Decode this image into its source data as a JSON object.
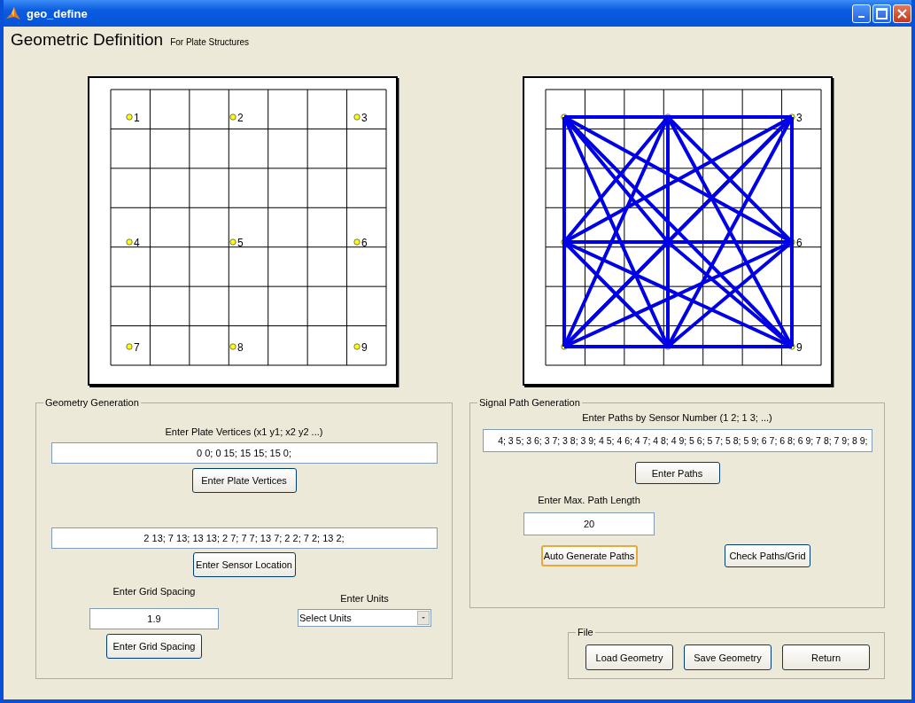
{
  "window": {
    "title": "geo_define"
  },
  "header": {
    "title": "Geometric Definition",
    "subtitle": "For Plate Structures"
  },
  "plots": [
    {
      "kind": "sensor-map",
      "sensors": [
        {
          "label": "1"
        },
        {
          "label": "2"
        },
        {
          "label": "3"
        },
        {
          "label": "4"
        },
        {
          "label": "5"
        },
        {
          "label": "6"
        },
        {
          "label": "7"
        },
        {
          "label": "8"
        },
        {
          "label": "9"
        }
      ]
    },
    {
      "kind": "path-map",
      "labels": [
        {
          "text": "3"
        },
        {
          "text": "6"
        },
        {
          "text": "9"
        }
      ]
    }
  ],
  "geometry_panel": {
    "title": "Geometry Generation",
    "vertices_label": "Enter Plate Vertices (x1 y1; x2 y2 ...)",
    "vertices_value": "0 0; 0 15; 15 15; 15 0;",
    "vertices_button": "Enter Plate Vertices",
    "sensor_value": "2 13; 7 13; 13 13; 2 7; 7 7; 13 7; 2 2; 7 2; 13 2;",
    "sensor_button": "Enter Sensor Location",
    "grid_label": "Enter Grid Spacing",
    "grid_value": "1.9",
    "grid_button": "Enter Grid Spacing",
    "units_label": "Enter Units",
    "units_value": "Select Units"
  },
  "signal_panel": {
    "title": "Signal Path Generation",
    "paths_label": "Enter Paths by Sensor Number (1 2; 1 3; ...)",
    "paths_value": "4; 3 5; 3 6; 3 7; 3 8; 3 9; 4 5; 4 6; 4 7; 4 8; 4 9; 5 6; 5 7; 5 8; 5 9; 6 7; 6 8; 6 9; 7 8; 7 9; 8 9;",
    "paths_button": "Enter Paths",
    "max_label": "Enter Max. Path Length",
    "max_value": "20",
    "auto_button": {
      "label": "Auto Generate Paths",
      "focused": true
    },
    "check_button": "Check Paths/Grid"
  },
  "file_panel": {
    "title": "File",
    "buttons": [
      {
        "label": "Load Geometry"
      },
      {
        "label": "Save Geometry"
      },
      {
        "label": "Return"
      }
    ]
  }
}
